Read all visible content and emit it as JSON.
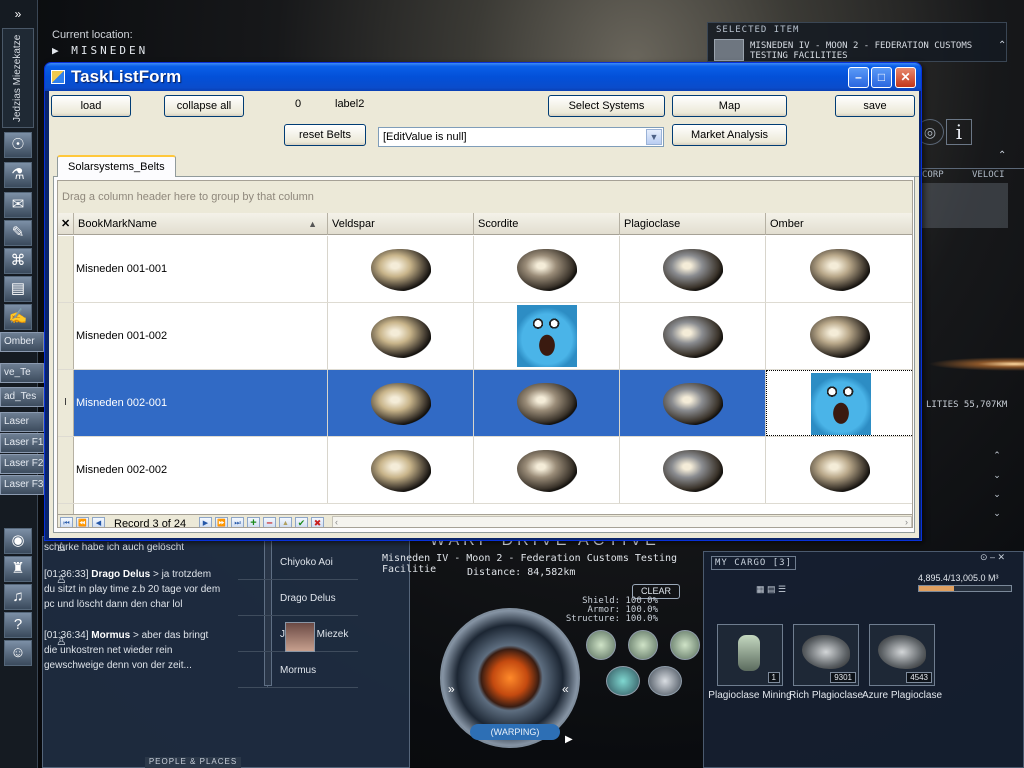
{
  "game": {
    "pilot_name": "Jedzias Miezekatze",
    "location_label": "Current location:",
    "location_value": "MISNEDEN",
    "selected_item": {
      "title": "SELECTED ITEM",
      "name": "MISNEDEN IV - MOON 2 - FEDERATION CUSTOMS TESTING FACILITIES"
    },
    "overview_columns": [
      "CORP",
      "VELOCI"
    ],
    "overview_distance": "LITIES 55,707KM",
    "info_button": "i",
    "side_channels": [
      "Omber",
      "ve_Te",
      "ad_Tes",
      "Laser",
      "Laser F1",
      "Laser F2",
      "Laser F3"
    ],
    "chat": [
      {
        "time": "",
        "name": "",
        "text": "schurke habe ich auch gelöscht"
      },
      {
        "time": "",
        "name": "Drago Delus",
        "text": " > ja trotzdem du sitzt in play time z.b 20 tage vor dem pc und löscht dann den char lol"
      },
      {
        "time": "[01:36:33]",
        "name": "",
        "text": ""
      },
      {
        "time": "[01:36:34]",
        "name": "Mormus",
        "text": " > aber das bringt die unkostren net wieder rein gewschweige denn von der zeit..."
      }
    ],
    "members": [
      "Chiyoko Aoi",
      "Drago Delus",
      "Jedzias Miezek",
      "Mormus"
    ],
    "people_tab": "PEOPLE & PLACES",
    "warp_status": "WARP DRIVE ACTIVE",
    "warp_destination": "Misneden IV - Moon 2 - Federation Customs Testing Facilitie",
    "warp_distance": "Distance: 84,582km",
    "clear_button": "CLEAR",
    "stats": {
      "shield": "Shield: 100.0%",
      "armor": "Armor: 100.0%",
      "structure": "Structure: 100.0%"
    },
    "warping_label": "(WARPING)",
    "cargo": {
      "title": "MY CARGO [3]",
      "capacity": "4,895.4/13,005.0 M³",
      "fill_fraction": 0.376,
      "items": [
        {
          "name": "Plagioclase Mining",
          "qty": "1"
        },
        {
          "name": "Rich Plagioclase",
          "qty": "9301"
        },
        {
          "name": "Azure Plagioclase",
          "qty": "4543"
        }
      ]
    }
  },
  "window": {
    "title": "TaskListForm",
    "buttons": {
      "load": "load",
      "collapse_all": "collapse all",
      "reset_belts": "reset Belts",
      "select_systems": "Select Systems",
      "map": "Map",
      "market_analysis": "Market Analysis",
      "save": "save"
    },
    "counter": "0",
    "label2": "label2",
    "combo_value": "[EditValue is null]",
    "tab": "Solarsystems_Belts",
    "group_hint": "Drag a column header here to group by that column",
    "columns": [
      "BookMarkName",
      "Veldspar",
      "Scordite",
      "Plagioclase",
      "Omber"
    ],
    "rows": [
      {
        "name": "Misneden 001-001",
        "cells": [
          "ore",
          "ore",
          "ore",
          "ore"
        ]
      },
      {
        "name": "Misneden 001-002",
        "cells": [
          "ore",
          "cookie",
          "ore",
          "ore"
        ]
      },
      {
        "name": "Misneden 002-001",
        "cells": [
          "ore",
          "ore",
          "ore",
          "cookie"
        ]
      },
      {
        "name": "Misneden 002-002",
        "cells": [
          "ore",
          "ore",
          "ore",
          "ore"
        ]
      }
    ],
    "record_text": "Record 3 of 24",
    "colors": {
      "selection": "#316ac5",
      "titlebar": "#0350d8",
      "close": "#c2361a"
    }
  }
}
